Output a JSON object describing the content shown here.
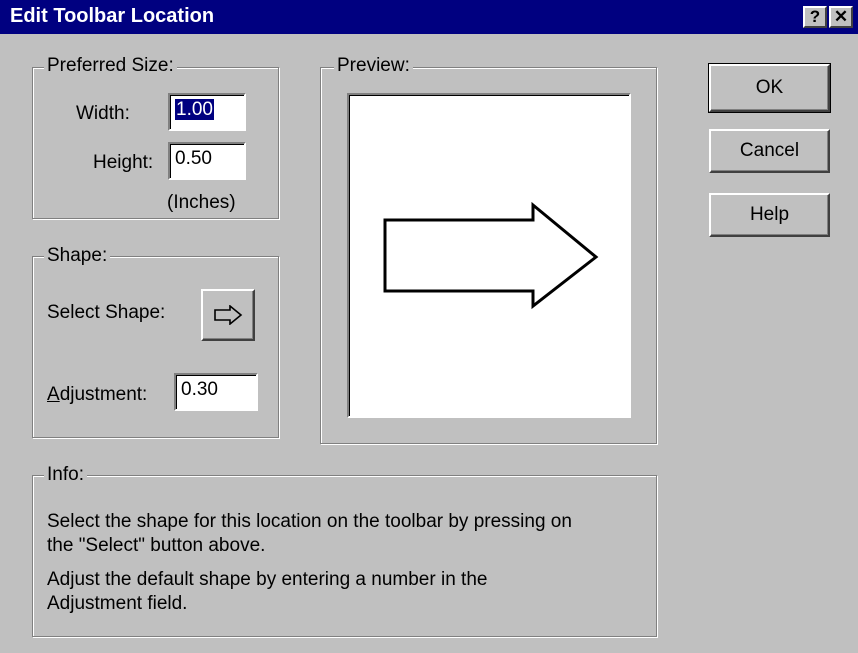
{
  "window": {
    "title": "Edit Toolbar Location",
    "help_glyph": "?",
    "close_glyph": "✕"
  },
  "preferred_size": {
    "legend": "Preferred Size:",
    "width_label": "Width:",
    "width_value": "1.00",
    "height_label": "Height:",
    "height_value": "0.50",
    "units": "(Inches)"
  },
  "shape": {
    "legend": "Shape:",
    "select_label": "Select Shape:",
    "select_icon": "right-arrow-icon",
    "adjustment_label": "Adjustment:",
    "adjustment_value": "0.30"
  },
  "preview": {
    "legend": "Preview:",
    "shape_icon": "right-arrow-outline"
  },
  "info": {
    "legend": "Info:",
    "line1": "Select the shape for this location on the toolbar by pressing on",
    "line2": "the \"Select\" button above.",
    "line3": "Adjust the default shape by entering a number in the",
    "line4": "Adjustment field."
  },
  "buttons": {
    "ok": "OK",
    "cancel": "Cancel",
    "help": "Help"
  }
}
